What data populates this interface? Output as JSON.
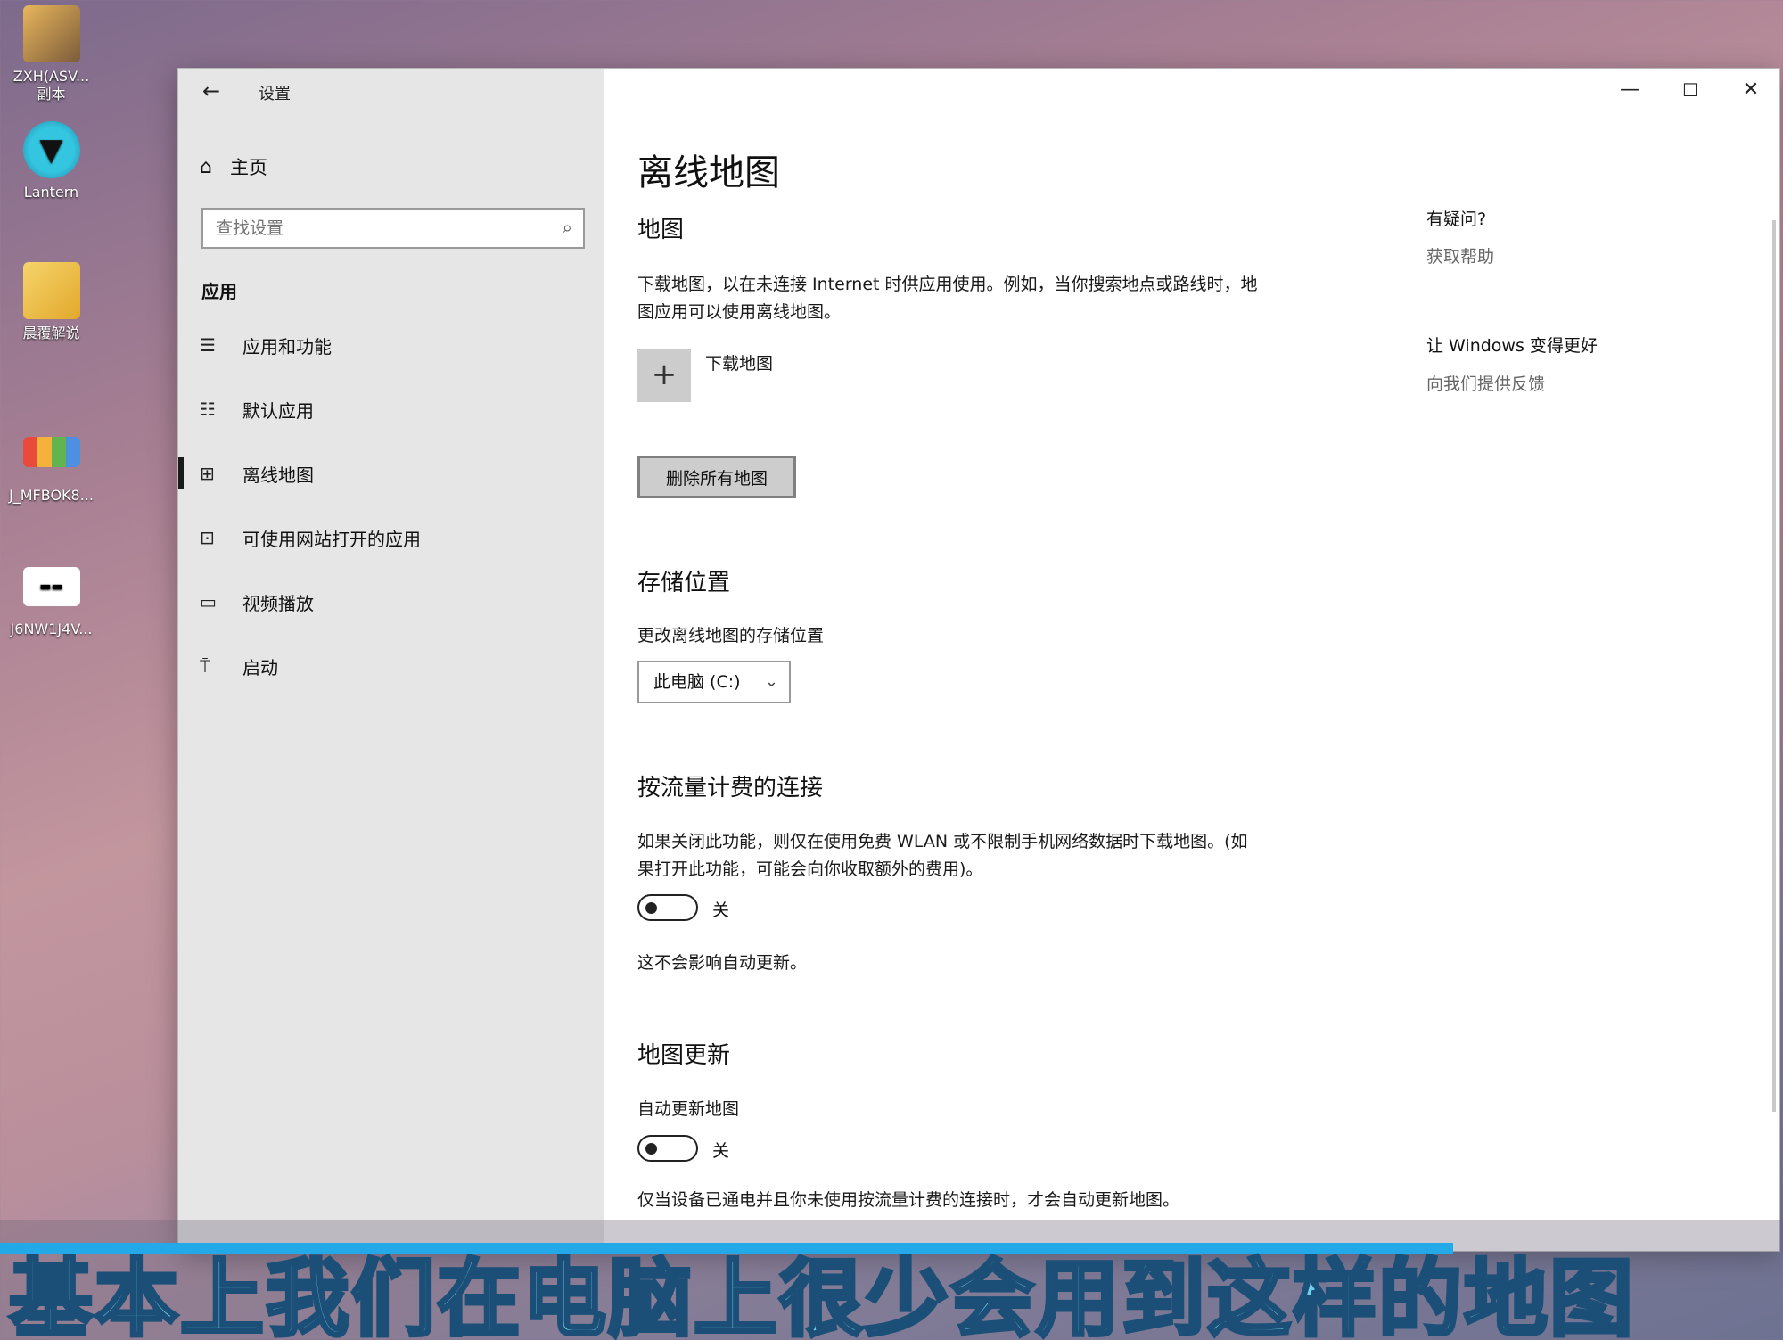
{
  "desktop": {
    "icons": [
      {
        "label": "ZXH(ASV...\n副本"
      },
      {
        "label": "Lantern"
      },
      {
        "label": "晨覆解说"
      },
      {
        "label": "J_MFBOK8..."
      },
      {
        "label": "J6NW1J4V..."
      }
    ]
  },
  "window": {
    "title": "设置",
    "back_glyph": "←",
    "controls": {
      "minimize": "—",
      "maximize": "☐",
      "close": "✕"
    }
  },
  "sidebar": {
    "home_label": "主页",
    "search_placeholder": "查找设置",
    "section_title": "应用",
    "items": [
      {
        "label": "应用和功能",
        "icon": "apps-features-icon"
      },
      {
        "label": "默认应用",
        "icon": "default-apps-icon"
      },
      {
        "label": "离线地图",
        "icon": "offline-maps-icon",
        "active": true
      },
      {
        "label": "可使用网站打开的应用",
        "icon": "apps-for-websites-icon"
      },
      {
        "label": "视频播放",
        "icon": "video-playback-icon"
      },
      {
        "label": "启动",
        "icon": "startup-icon"
      }
    ]
  },
  "main": {
    "page_title": "离线地图",
    "maps": {
      "heading": "地图",
      "description": "下载地图，以在未连接 Internet 时供应用使用。例如，当你搜索地点或路线时，地图应用可以使用离线地图。",
      "add_label": "下载地图",
      "delete_button": "删除所有地图"
    },
    "storage": {
      "heading": "存储位置",
      "description": "更改离线地图的存储位置",
      "selected": "此电脑 (C:)"
    },
    "metered": {
      "heading": "按流量计费的连接",
      "description": "如果关闭此功能，则仅在使用免费 WLAN 或不限制手机网络数据时下载地图。(如果打开此功能，可能会向你收取额外的费用)。",
      "toggle_state": "关",
      "note": "这不会影响自动更新。"
    },
    "updates": {
      "heading": "地图更新",
      "description": "自动更新地图",
      "toggle_state": "关",
      "note": "仅当设备已通电并且你未使用按流量计费的连接时，才会自动更新地图。"
    }
  },
  "aside": {
    "question_heading": "有疑问?",
    "help_link": "获取帮助",
    "feedback_heading": "让 Windows 变得更好",
    "feedback_link": "向我们提供反馈"
  },
  "video": {
    "caption": "基本上我们在电脑上很少会用到这样的地图",
    "progress_fraction": 0.815
  }
}
